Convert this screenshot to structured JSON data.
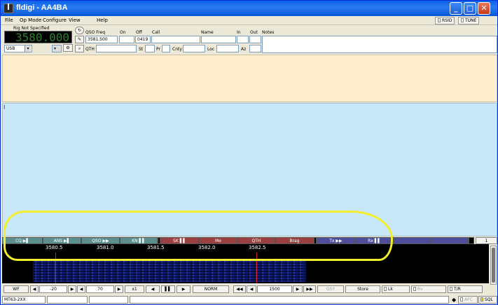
{
  "window": {
    "title": "fldigi - AA4BA"
  },
  "menu": {
    "items": [
      "File",
      "Op Mode",
      "Configure",
      "View",
      "Help"
    ],
    "toggles": [
      "RSID",
      "TUNE"
    ]
  },
  "rig": {
    "name": "Rig Not Specified",
    "frequency": "3580.000",
    "mode": "USB"
  },
  "log": {
    "labels": {
      "qso_freq": "QSO Freq",
      "on": "On",
      "off": "Off",
      "call": "Call",
      "name": "Name",
      "in": "In",
      "out": "Out",
      "notes": "Notes",
      "qth": "QTH",
      "st": "St",
      "pr": "Pr",
      "cnty": "Cnty",
      "loc": "Loc",
      "az": "Az"
    },
    "values": {
      "qso_freq": "3581.500",
      "on": "",
      "off": "0419",
      "call": "",
      "name": "",
      "in": "",
      "out": "",
      "notes": ""
    }
  },
  "tx": {
    "cursor": "I"
  },
  "macros": {
    "buttons": [
      {
        "label": "CQ ▶▌",
        "color": "teal"
      },
      {
        "label": "ANS ▶▌",
        "color": "teal"
      },
      {
        "label": "QSO ▶▶",
        "color": "teal"
      },
      {
        "label": "KN ▌▌",
        "color": "teal"
      },
      {
        "label": "SK ▌▌",
        "color": "red"
      },
      {
        "label": "Me",
        "color": "red"
      },
      {
        "label": "QTH",
        "color": "red"
      },
      {
        "label": "Brag",
        "color": "red"
      },
      {
        "label": "Tx ▶▶",
        "color": "blue"
      },
      {
        "label": "Rx ▌▌",
        "color": "blue"
      }
    ],
    "page": "1"
  },
  "waterfall": {
    "ticks": [
      "3580.5",
      "3581.0",
      "3581.5",
      "3582.0",
      "3582.5"
    ]
  },
  "controls": {
    "wf": "WF",
    "level": "-20",
    "range": "70",
    "zoom": "x1",
    "mode": "NORM",
    "freq": "1500",
    "qsy": "QSY",
    "store": "Store",
    "lk": "Lk",
    "rv": "Rv",
    "tr": "T/R"
  },
  "status": {
    "mode": "MT63-2XX",
    "afc": "AFC",
    "sql": "SQL"
  }
}
